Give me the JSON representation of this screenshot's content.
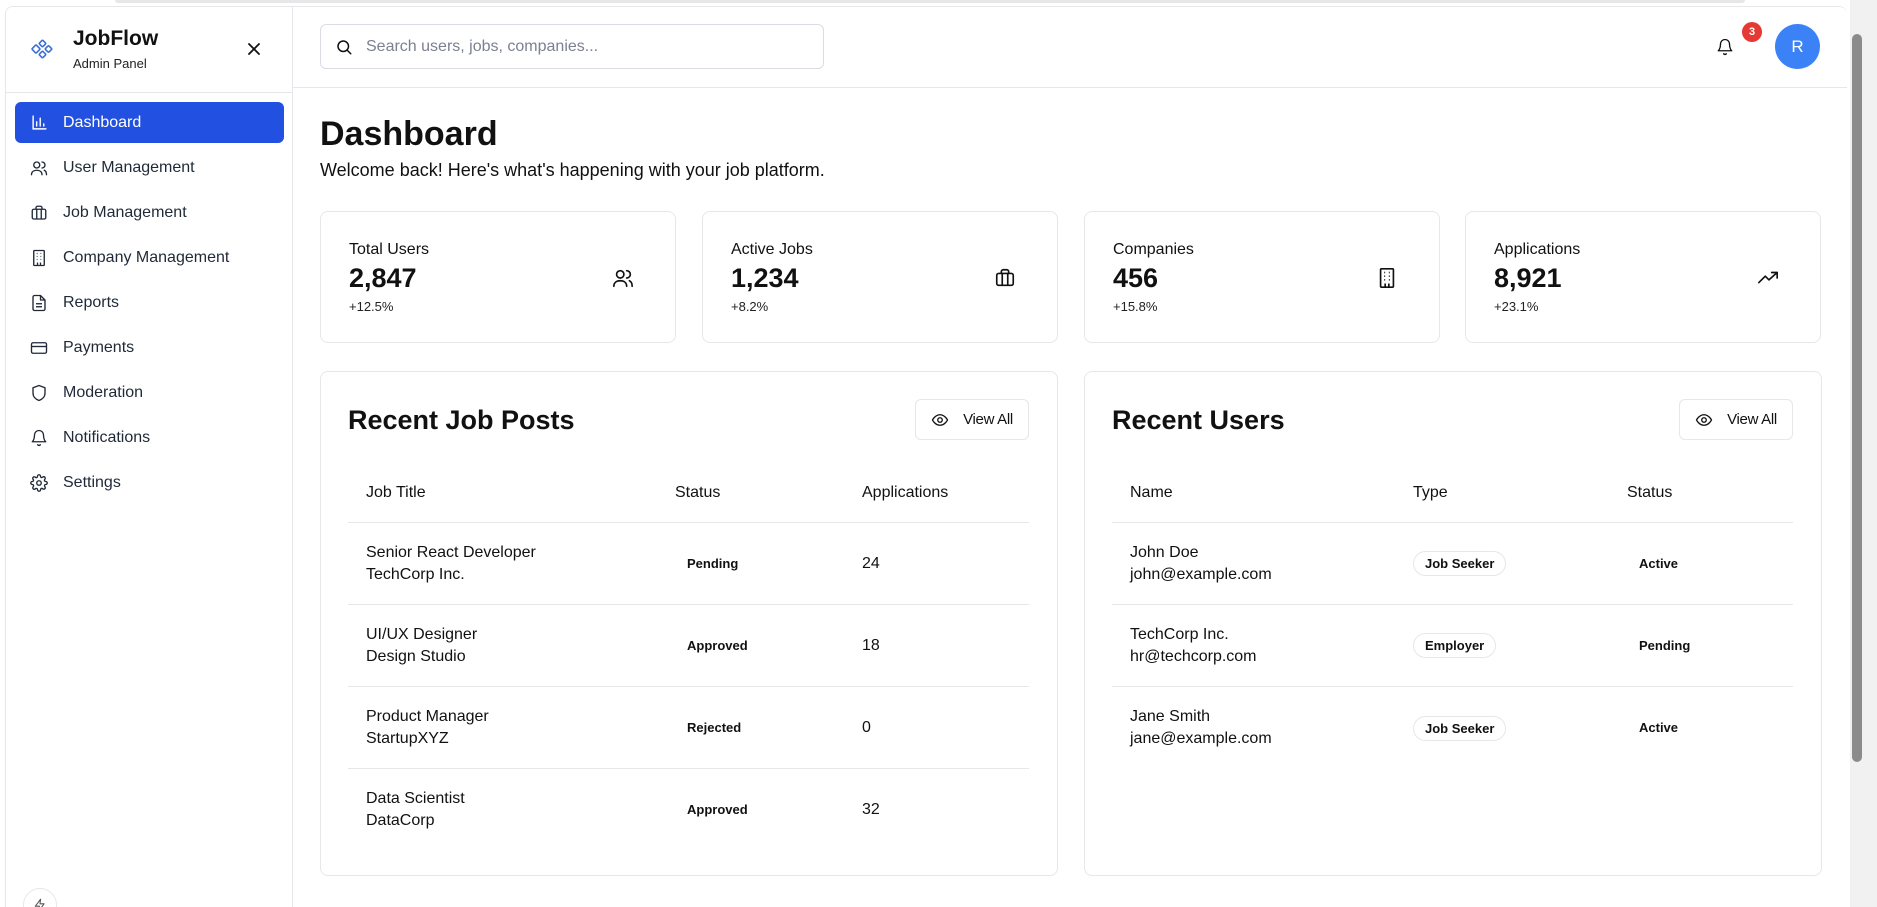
{
  "brand": {
    "title": "JobFlow",
    "subtitle": "Admin Panel",
    "logo_icon": "workflow-icon",
    "close_icon": "close-icon"
  },
  "sidebar": {
    "items": [
      {
        "label": "Dashboard",
        "icon": "bar-chart-icon",
        "active": true
      },
      {
        "label": "User Management",
        "icon": "users-icon",
        "active": false
      },
      {
        "label": "Job Management",
        "icon": "briefcase-icon",
        "active": false
      },
      {
        "label": "Company Management",
        "icon": "building-icon",
        "active": false
      },
      {
        "label": "Reports",
        "icon": "file-text-icon",
        "active": false
      },
      {
        "label": "Payments",
        "icon": "credit-card-icon",
        "active": false
      },
      {
        "label": "Moderation",
        "icon": "shield-icon",
        "active": false
      },
      {
        "label": "Notifications",
        "icon": "bell-icon",
        "active": false
      },
      {
        "label": "Settings",
        "icon": "gear-icon",
        "active": false
      }
    ],
    "active_color": "#2250e0"
  },
  "header": {
    "search_placeholder": "Search users, jobs, companies...",
    "notification_count": "3",
    "avatar_initial": "R",
    "avatar_color": "#3b82f6",
    "badge_color": "#e53935"
  },
  "page": {
    "title": "Dashboard",
    "subtitle": "Welcome back! Here's what's happening with your job platform."
  },
  "stats": [
    {
      "label": "Total Users",
      "value": "2,847",
      "change": "+12.5%",
      "icon": "users-icon"
    },
    {
      "label": "Active Jobs",
      "value": "1,234",
      "change": "+8.2%",
      "icon": "briefcase-icon"
    },
    {
      "label": "Companies",
      "value": "456",
      "change": "+15.8%",
      "icon": "building-icon"
    },
    {
      "label": "Applications",
      "value": "8,921",
      "change": "+23.1%",
      "icon": "trending-up-icon"
    }
  ],
  "recent_jobs": {
    "title": "Recent Job Posts",
    "view_all": "View All",
    "columns": [
      "Job Title",
      "Status",
      "Applications"
    ],
    "rows": [
      {
        "title": "Senior React Developer",
        "company": "TechCorp Inc.",
        "status": "Pending",
        "applications": "24"
      },
      {
        "title": "UI/UX Designer",
        "company": "Design Studio",
        "status": "Approved",
        "applications": "18"
      },
      {
        "title": "Product Manager",
        "company": "StartupXYZ",
        "status": "Rejected",
        "applications": "0"
      },
      {
        "title": "Data Scientist",
        "company": "DataCorp",
        "status": "Approved",
        "applications": "32"
      }
    ]
  },
  "recent_users": {
    "title": "Recent Users",
    "view_all": "View All",
    "columns": [
      "Name",
      "Type",
      "Status"
    ],
    "rows": [
      {
        "name": "John Doe",
        "email": "john@example.com",
        "type": "Job Seeker",
        "status": "Active"
      },
      {
        "name": "TechCorp Inc.",
        "email": "hr@techcorp.com",
        "type": "Employer",
        "status": "Pending"
      },
      {
        "name": "Jane Smith",
        "email": "jane@example.com",
        "type": "Job Seeker",
        "status": "Active"
      }
    ]
  }
}
